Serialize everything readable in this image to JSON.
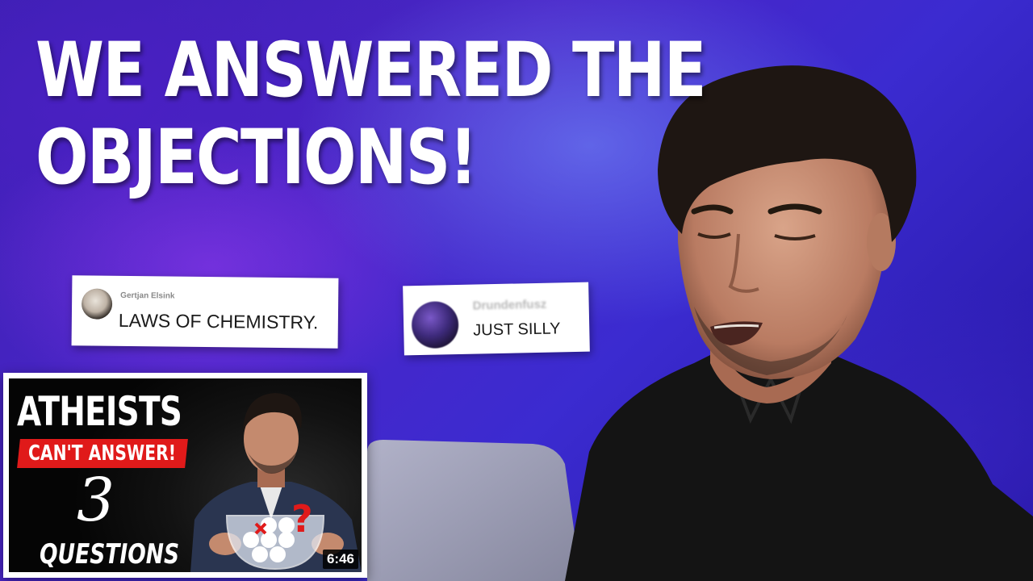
{
  "headline": {
    "line1": "WE ANSWERED THE",
    "line2": "OBJECTIONS!"
  },
  "comments": [
    {
      "name": "Gertjan Elsink",
      "text": "LAWS OF CHEMISTRY."
    },
    {
      "name": "Drundenfusz",
      "text": "JUST SILLY"
    }
  ],
  "thumbnail": {
    "title": "ATHEISTS",
    "banner": "CAN'T ANSWER!",
    "number": "3",
    "subtitle": "QUESTIONS",
    "duration": "6:46",
    "banner_color": "#e01a1a"
  },
  "colors": {
    "background": "#3a20b0",
    "headline": "#ffffff"
  }
}
